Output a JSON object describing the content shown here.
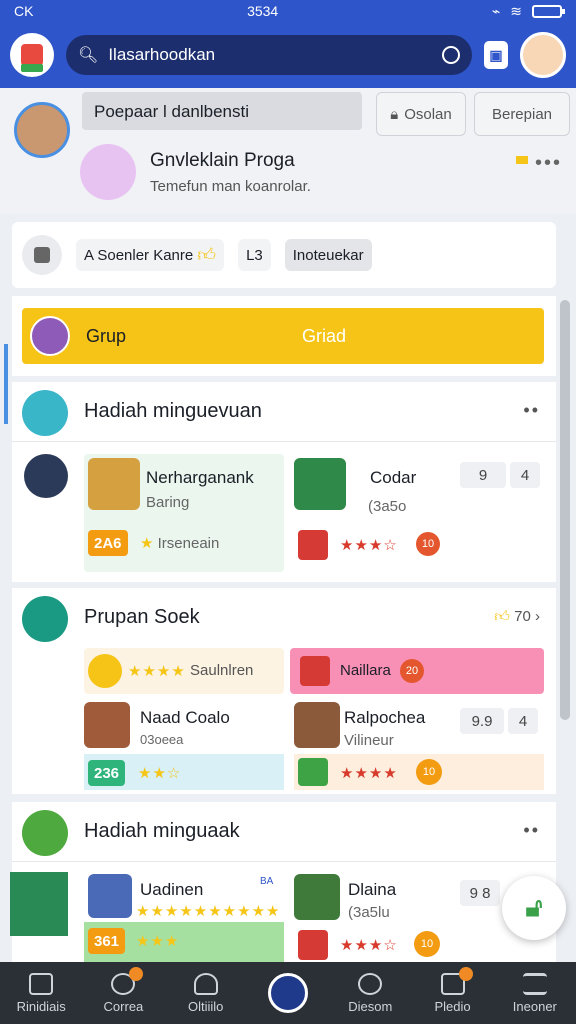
{
  "status": {
    "left": "CK",
    "time": "3534"
  },
  "search": {
    "placeholder": "Ilasarhoodkan"
  },
  "profile": {
    "name_box": "Poepaar l danlbensti",
    "tab_1": "Osolan",
    "tab_2": "Berepian",
    "user_name": "Gnvleklain Proga",
    "user_sub": "Temefun man koanrolar."
  },
  "filters": {
    "chip_1": "A Soenler Kanre",
    "chip_2": "L3",
    "chip_3": "Inoteuekar"
  },
  "grup": {
    "label": "Grup",
    "right_label": "Griad"
  },
  "section1": {
    "title": "Hadiah minguevuan",
    "card_left": {
      "title": "Nerharganank",
      "sub": "Baring",
      "badge": "2A6",
      "note": "Irseneain"
    },
    "card_right": {
      "title": "Codar",
      "sub": "(3a5o",
      "button": "9",
      "button2": "4",
      "stars": "★★★☆",
      "dot": "10"
    }
  },
  "section2": {
    "title": "Prupan Soek",
    "link": "70",
    "row1_left": "Saulnlren",
    "row1_right": "Naillara",
    "row1_right_dot": "20",
    "card_left": {
      "title": "Naad Coalo",
      "sub": "03oeea",
      "badge": "236",
      "stars": "★★☆"
    },
    "card_right": {
      "title": "Ralpochea",
      "sub": "Vilineur",
      "button": "9.9",
      "button2": "4",
      "stars": "★★★★",
      "dot": "10"
    }
  },
  "section3": {
    "title": "Hadiah minguaak",
    "card_left": {
      "title": "Uadinen",
      "tag": "BA",
      "badge": "361",
      "stars": "★★★★★★★★★★",
      "small_stars": "★★★"
    },
    "card_right": {
      "title": "Dlaina",
      "sub": "(3a5lu",
      "button": "9 8",
      "stars": "★★★☆",
      "dot": "10"
    }
  },
  "nav": [
    {
      "label": "Rinidiais"
    },
    {
      "label": "Correa"
    },
    {
      "label": "Oltiiilo"
    },
    {
      "label": ""
    },
    {
      "label": "Diesom"
    },
    {
      "label": "Pledio"
    },
    {
      "label": "Ineoner"
    }
  ],
  "colors": {
    "primary": "#2e55c9",
    "accent": "#f6c417",
    "star": "#d83b2b"
  }
}
